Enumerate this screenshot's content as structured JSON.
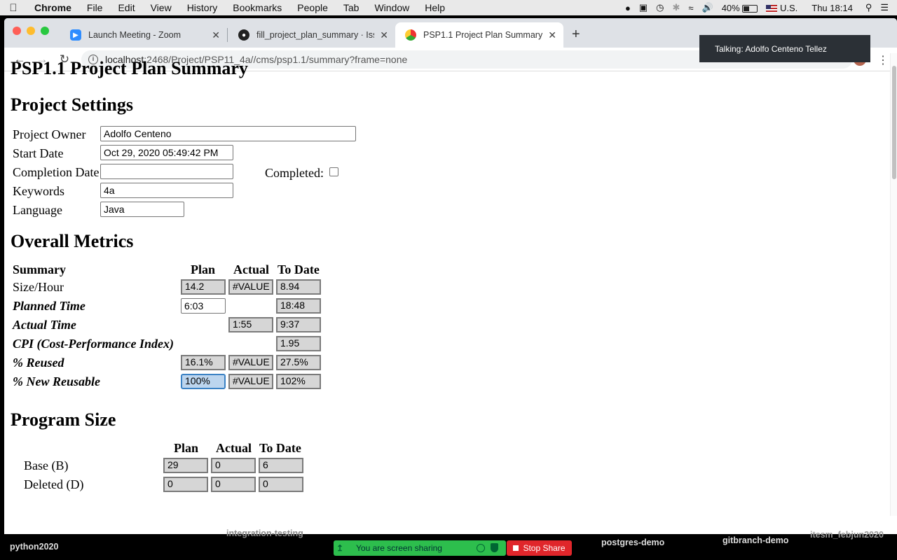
{
  "menubar": {
    "app": "Chrome",
    "items": [
      "File",
      "Edit",
      "View",
      "History",
      "Bookmarks",
      "People",
      "Tab",
      "Window",
      "Help"
    ],
    "battery": "40%",
    "input_source": "U.S.",
    "clock": "Thu 18:14"
  },
  "tabs": [
    {
      "title": "Launch Meeting - Zoom",
      "icon": "zoom-icon"
    },
    {
      "title": "fill_project_plan_summary · Issu",
      "icon": "github-icon"
    },
    {
      "title": "PSP1.1 Project Plan Summary",
      "icon": "chrome-favicon"
    }
  ],
  "omnibox": {
    "host": "localhost",
    "path": ":2468/Project/PSP11_4a//cms/psp1.1/summary?frame=none"
  },
  "page": {
    "title": "PSP1.1 Project Plan Summary",
    "settings": {
      "heading": "Project Settings",
      "owner_label": "Project Owner",
      "owner_value": "Adolfo Centeno",
      "start_label": "Start Date",
      "start_value": "Oct 29, 2020 05:49:42 PM",
      "completion_label": "Completion Date",
      "completion_value": "",
      "completed_label": "Completed:",
      "keywords_label": "Keywords",
      "keywords_value": "4a",
      "language_label": "Language",
      "language_value": "Java"
    },
    "overall": {
      "heading": "Overall Metrics",
      "headers": {
        "summary": "Summary",
        "plan": "Plan",
        "actual": "Actual",
        "todate": "To Date"
      },
      "rows": {
        "size_hour": {
          "label": "Size/Hour",
          "plan": "14.2",
          "actual": "#VALUE",
          "todate": "8.94"
        },
        "planned_time": {
          "label": "Planned Time",
          "plan": "6:03",
          "todate": "18:48"
        },
        "actual_time": {
          "label": "Actual Time",
          "actual": "1:55",
          "todate": "9:37"
        },
        "cpi": {
          "label": "CPI (Cost-Performance Index)",
          "todate": "1.95"
        },
        "reused": {
          "label": "% Reused",
          "plan": "16.1%",
          "actual": "#VALUE",
          "todate": "27.5%"
        },
        "new_reusable": {
          "label": "% New Reusable",
          "plan": "100%",
          "actual": "#VALUE",
          "todate": "102%"
        }
      }
    },
    "program_size": {
      "heading": "Program Size",
      "headers": {
        "plan": "Plan",
        "actual": "Actual",
        "todate": "To Date"
      },
      "rows": {
        "base": {
          "label": "Base (B)",
          "plan": "29",
          "actual": "0",
          "todate": "6"
        },
        "deleted": {
          "label": "Deleted (D)",
          "plan": "0",
          "actual": "0",
          "todate": "0"
        }
      }
    }
  },
  "zoom": {
    "talking": "Talking: Adolfo Centeno Tellez",
    "sharing_text": "You are screen sharing",
    "stop_share": "Stop Share",
    "dock_labels": {
      "a": "python2020",
      "b": "integration-testing",
      "c": "postgres-demo",
      "d": "gitbranch-demo",
      "e": "itesm_febjun2020"
    }
  }
}
